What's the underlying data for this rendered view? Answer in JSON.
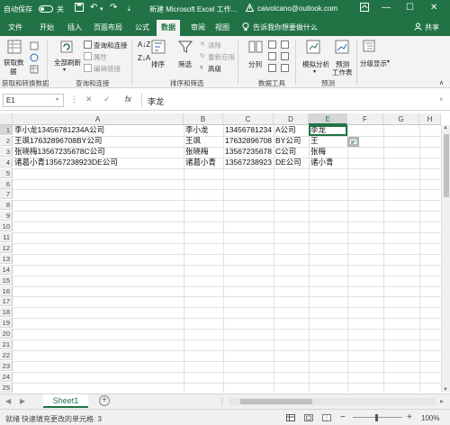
{
  "titlebar": {
    "autosave_label": "自动保存",
    "autosave_state": "关",
    "doc_title": "新建 Microsoft Excel 工作...",
    "user_email": "caivolcano@outlook.com"
  },
  "tabs": [
    "文件",
    "开始",
    "插入",
    "页面布局",
    "公式",
    "数据",
    "审阅",
    "视图"
  ],
  "active_tab": "数据",
  "tell_me": "告诉我你想要做什么",
  "share_label": "共享",
  "ribbon": {
    "get_data_line1": "获取数",
    "get_data_line2": "据",
    "refresh_all": "全部刷新",
    "queries_connections": "查询和连接",
    "properties": "属性",
    "edit_links": "编辑链接",
    "sort": "排序",
    "filter": "筛选",
    "clear": "清除",
    "reapply": "重新应用",
    "advanced": "高级",
    "text_to_columns": "分列",
    "what_if_line1": "模拟分析",
    "forecast_line1": "预测",
    "forecast_line2": "工作表",
    "outline": "分级显示",
    "groups": {
      "get_transform": "获取和转换数据",
      "queries": "查询和连接",
      "sort_filter": "排序和筛选",
      "data_tools": "数据工具",
      "forecast": "预测"
    }
  },
  "formula_bar": {
    "name_box": "E1",
    "cancel": "✕",
    "enter": "✓",
    "fx": "fx",
    "value": "李龙"
  },
  "columns": [
    "A",
    "B",
    "C",
    "D",
    "E",
    "F",
    "G",
    "H"
  ],
  "selected_column": "E",
  "row_count": 27,
  "cells": {
    "A": [
      "李小龙13456781234A公司",
      "王飒17632896708BY公司",
      "张晓梅13567235678C公司",
      "诸葛小青13567238923DE公司"
    ],
    "B": [
      "李小龙",
      "王飒",
      "张晓梅",
      "诸葛小青"
    ],
    "C": [
      "13456781234",
      "17632896708",
      "13567235678",
      "13567238923"
    ],
    "D": [
      "A公司",
      "BY公司",
      "C公司",
      "DE公司"
    ],
    "E": [
      "李龙",
      "王",
      "张梅",
      "诸小青"
    ]
  },
  "sheet_tab": "Sheet1",
  "status": {
    "ready": "就绪",
    "message": "快速填充更改的单元格: 3",
    "zoom": "100%"
  },
  "colors": {
    "excel_green": "#217346",
    "ribbon_bg": "#f3f3f3"
  }
}
